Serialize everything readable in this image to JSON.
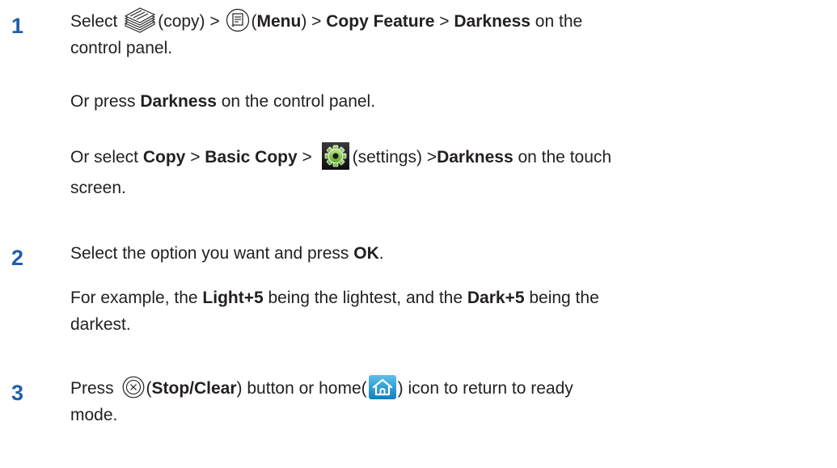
{
  "steps": [
    {
      "number": "1",
      "line1": {
        "t1": "Select ",
        "t2": "(copy) > ",
        "t3": "(",
        "menu": "Menu",
        "t4": ") > ",
        "copy_feature": "Copy Feature",
        "t5": " > ",
        "darkness": "Darkness",
        "t6": " on the"
      },
      "line2": "control panel.",
      "alt1": {
        "t1": "Or press ",
        "darkness": "Darkness",
        "t2": " on the control panel."
      },
      "alt2": {
        "t1": "Or select ",
        "copy": "Copy",
        "t2": " > ",
        "basic_copy": "Basic Copy",
        "t3": " > ",
        "t4": "(settings) >",
        "darkness": "Darkness",
        "t5": " on the touch"
      },
      "alt2_line2": "screen."
    },
    {
      "number": "2",
      "line1": {
        "t1": "Select the option you want and press ",
        "ok": "OK",
        "t2": "."
      },
      "example": {
        "t1": "For example, the ",
        "light": "Light+5",
        "t2": " being the lightest, and the ",
        "dark": "Dark+5",
        "t3": " being the"
      },
      "example_line2": "darkest."
    },
    {
      "number": "3",
      "line1": {
        "t1": "Press ",
        "t2": "(",
        "stop": "Stop/Clear",
        "t3": ") button or home(",
        "t4": ") icon to return to ready"
      },
      "line2": "mode."
    }
  ],
  "icons": {
    "copy": "copy-icon",
    "menu": "menu-icon",
    "settings": "settings-icon",
    "stop": "stop-clear-icon",
    "home": "home-icon"
  },
  "colors": {
    "step_number": "#1f5fa8",
    "text": "#231f20",
    "home_button": "#1c93d1"
  }
}
